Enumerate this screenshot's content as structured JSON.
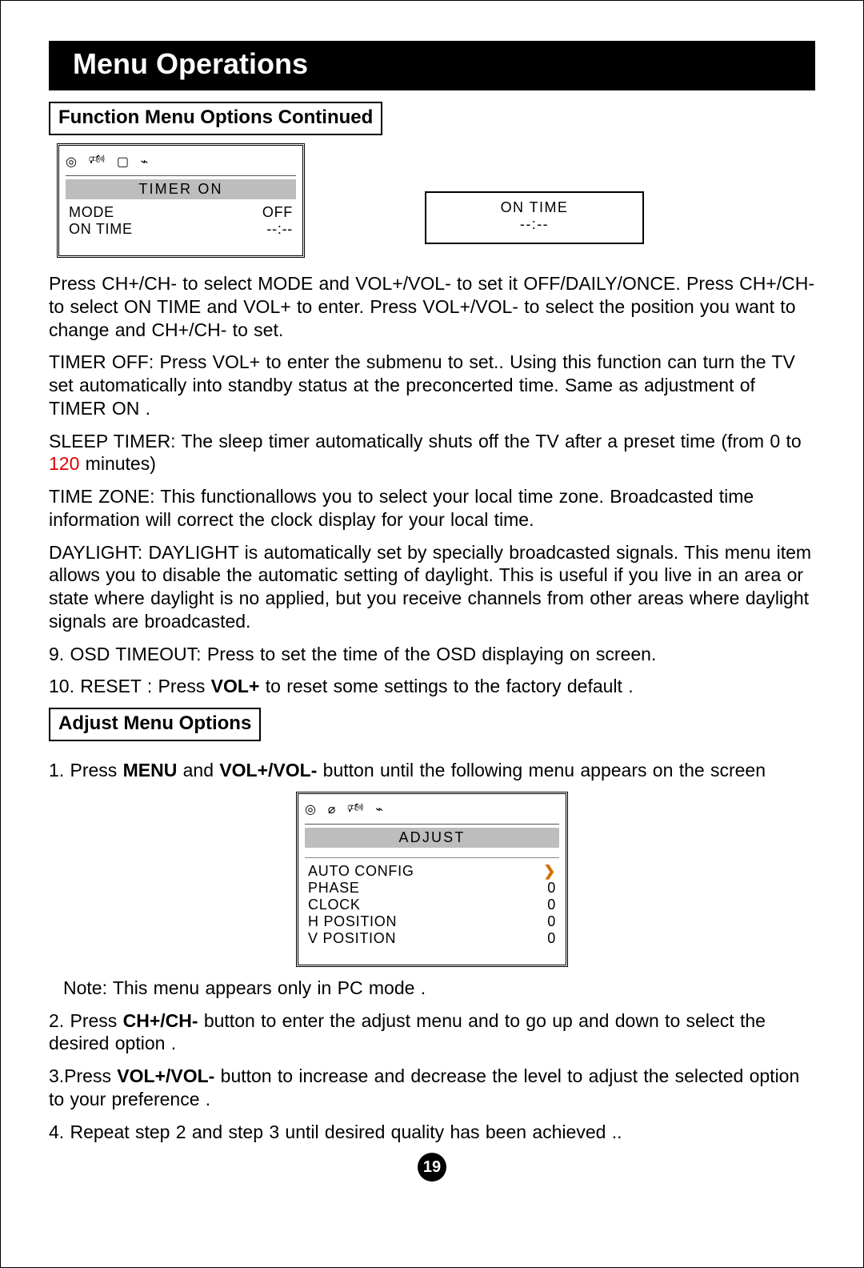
{
  "title": "Menu Operations",
  "section1": "Function Menu Options Continued",
  "timer_on_osd": {
    "title": "TIMER ON",
    "rows": [
      {
        "label": "MODE",
        "value": "OFF"
      },
      {
        "label": "ON TIME",
        "value": "--:--"
      }
    ]
  },
  "ontime_box": {
    "label": "ON TIME",
    "value": "--:--"
  },
  "para1": "Press CH+/CH- to select MODE and VOL+/VOL- to set it OFF/DAILY/ONCE. Press CH+/CH- to select ON TIME and VOL+ to enter. Press VOL+/VOL- to select the position you want to change and CH+/CH- to set.",
  "para2": "TIMER OFF: Press VOL+ to enter the submenu to set.. Using this function can turn the TV set automatically into standby status at the preconcerted time. Same as adjustment of TIMER ON .",
  "para3_pre": "SLEEP TIMER: The sleep timer automatically shuts off the TV after a preset time (from 0 to ",
  "para3_red": "120",
  "para3_post": " minutes)",
  "para4": "TIME ZONE: This functionallows you to select your local time zone. Broadcasted time information will correct the clock display for your local time.",
  "para5": "DAYLIGHT: DAYLIGHT is automatically set by specially broadcasted signals. This menu item allows you to disable the automatic setting of daylight. This is useful if you live in an area or state where daylight is no applied, but you receive channels from other areas where daylight signals are broadcasted.",
  "para6": "9. OSD TIMEOUT: Press to set the time of the OSD displaying on screen.",
  "para7_pre": "10. RESET : Press ",
  "para7_bold": "VOL+",
  "para7_post": " to reset some settings to the factory default .",
  "section2": "Adjust  Menu Options",
  "step1_pre": "1. Press ",
  "step1_b1": "MENU",
  "step1_mid": " and ",
  "step1_b2": "VOL+/VOL-",
  "step1_post": " button until the following menu appears on the screen",
  "adjust_osd": {
    "title": "ADJUST",
    "rows": [
      {
        "label": "AUTO CONFIG",
        "value": "❯"
      },
      {
        "label": "PHASE",
        "value": "0"
      },
      {
        "label": "CLOCK",
        "value": "0"
      },
      {
        "label": "H POSITION",
        "value": "0"
      },
      {
        "label": "V POSITION",
        "value": "0"
      }
    ]
  },
  "note": "Note: This menu   appears only in  PC mode .",
  "step2_pre": "2. Press ",
  "step2_b": "CH+/CH-",
  "step2_post": " button to enter the adjust menu and to go up and down to select the desired option .",
  "step3_pre": "3.Press ",
  "step3_b": "VOL+/VOL-",
  "step3_post": " button to increase and decrease the level to adjust the selected option to your preference .",
  "step4": "4. Repeat step 2 and step 3 until desired quality has been achieved ..",
  "page_number": "19",
  "icons": {
    "video": "◎",
    "sound": "🕬",
    "picture": "▢",
    "tuner": "⌁",
    "adjust": "⌀"
  }
}
